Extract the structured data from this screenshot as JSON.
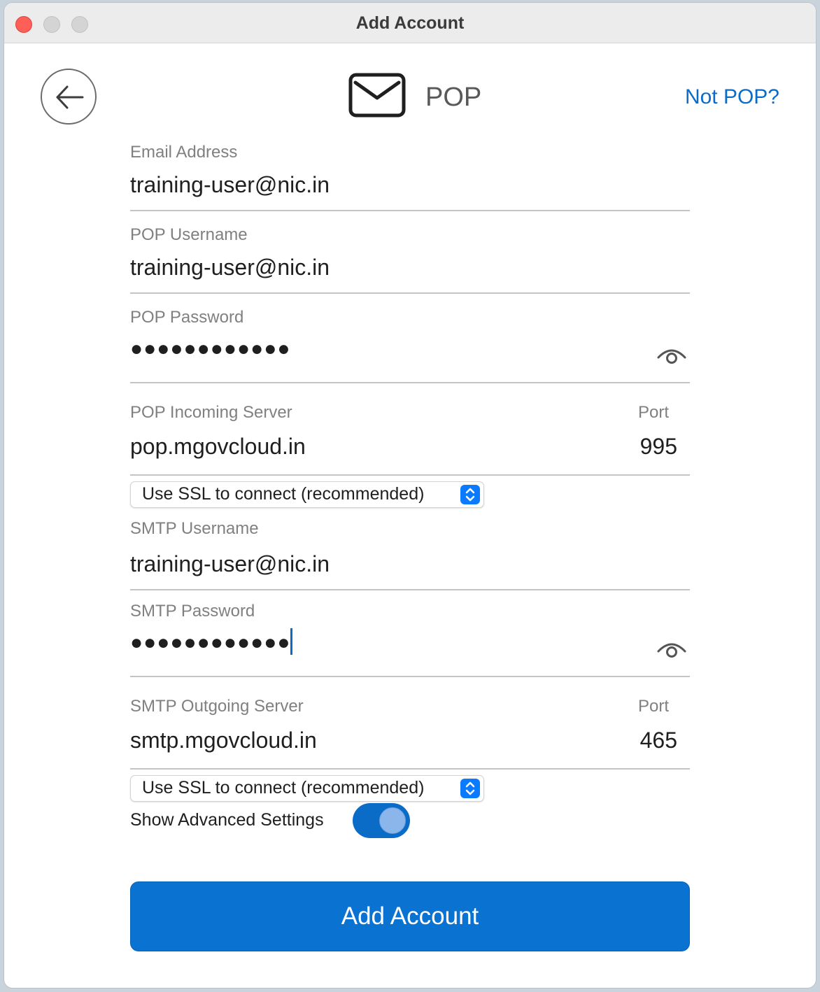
{
  "window": {
    "title": "Add Account"
  },
  "header": {
    "account_type": "POP",
    "not_link": "Not POP?"
  },
  "fields": {
    "email": {
      "label": "Email Address",
      "value": "training-user@nic.in"
    },
    "pop_username": {
      "label": "POP Username",
      "value": "training-user@nic.in"
    },
    "pop_password": {
      "label": "POP Password",
      "value": "●●●●●●●●●●●●"
    },
    "pop_server": {
      "label": "POP Incoming Server",
      "value": "pop.mgovcloud.in",
      "port_label": "Port",
      "port_value": "995"
    },
    "pop_ssl": "Use SSL to connect (recommended)",
    "smtp_username": {
      "label": "SMTP Username",
      "value": "training-user@nic.in"
    },
    "smtp_password": {
      "label": "SMTP Password",
      "value": "●●●●●●●●●●●●"
    },
    "smtp_server": {
      "label": "SMTP Outgoing Server",
      "value": "smtp.mgovcloud.in",
      "port_label": "Port",
      "port_value": "465"
    },
    "smtp_ssl": "Use SSL to connect (recommended)"
  },
  "advanced": {
    "label": "Show Advanced Settings",
    "enabled": true
  },
  "submit": {
    "label": "Add Account"
  },
  "icons": {
    "back": "arrow-left-icon",
    "mail": "envelope-icon",
    "eye": "eye-icon",
    "stepper": "chevron-updown-icon"
  },
  "colors": {
    "accent": "#0a72d0",
    "link": "#0a6cc7",
    "close": "#fe5f57"
  }
}
